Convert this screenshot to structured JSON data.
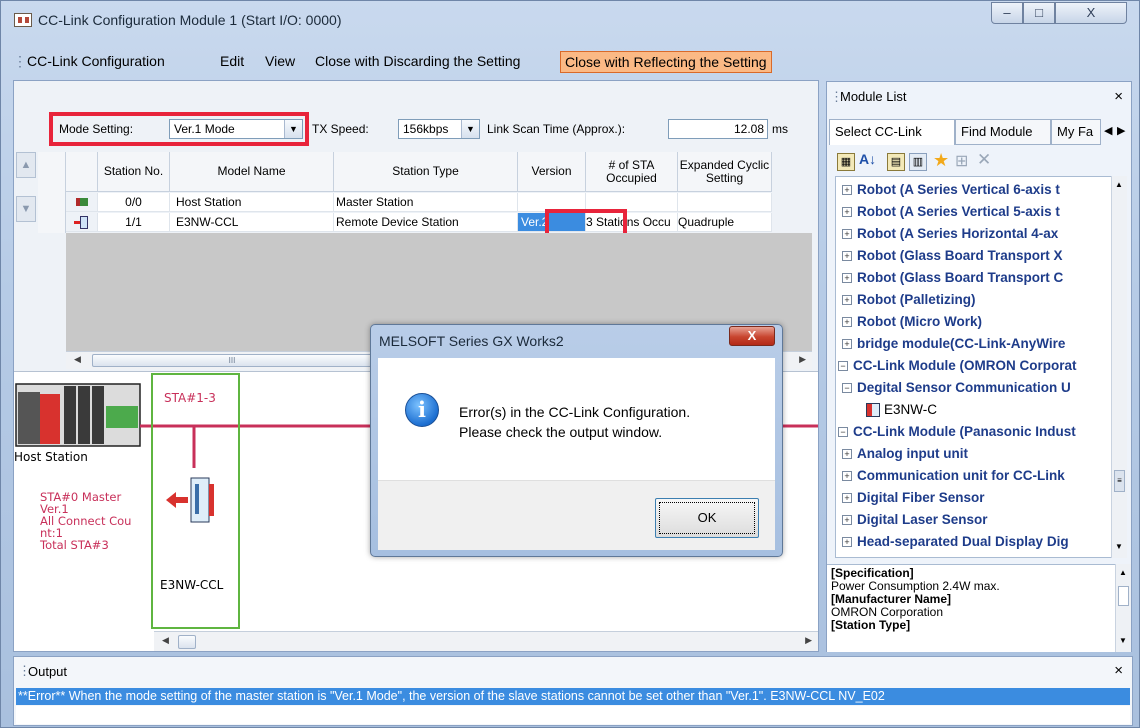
{
  "window": {
    "title": "CC-Link Configuration Module 1 (Start I/O: 0000)",
    "minimize_glyph": "–",
    "maximize_glyph": "□",
    "close_glyph": "X"
  },
  "menu": {
    "items": [
      "CC-Link Configuration",
      "Edit",
      "View",
      "Close with Discarding the Setting",
      "Close with Reflecting the Setting"
    ]
  },
  "settings": {
    "mode_label": "Mode Setting:",
    "mode_value": "Ver.1 Mode",
    "tx_label": "TX Speed:",
    "tx_value": "156kbps",
    "scan_label": "Link Scan Time (Approx.):",
    "scan_value": "12.08",
    "scan_unit": "ms"
  },
  "table": {
    "headers": [
      "Station No.",
      "Model Name",
      "Station Type",
      "Version",
      "# of STA Occupied",
      "Expanded Cyclic Setting"
    ],
    "rows": [
      {
        "icon": "master-station-icon",
        "station": "0/0",
        "model": "Host Station",
        "type": "Master Station",
        "version": "",
        "occupied": "",
        "expanded": ""
      },
      {
        "icon": "remote-device-icon",
        "station": "1/1",
        "model": "E3NW-CCL",
        "type": "Remote Device Station",
        "version": "Ver.2",
        "occupied": "3 Stations Occu",
        "expanded": "Quadruple"
      }
    ],
    "hscroll_glyph": "III"
  },
  "diagram": {
    "host_label": "Host Station",
    "host_info": [
      "STA#0  Master",
      "Ver.1",
      "All Connect Cou",
      "nt:1",
      "Total STA#3"
    ],
    "slave_sta": "STA#1-3",
    "slave_name": "E3NW-CCL"
  },
  "module_list": {
    "title": "Module List",
    "tabs": [
      "Select CC-Link",
      "Find Module",
      "My Fa"
    ],
    "tree": [
      {
        "text": "Robot (A Series Vertical 6-axis t",
        "level": 1,
        "kind": "plus"
      },
      {
        "text": "Robot (A Series Vertical 5-axis t",
        "level": 1,
        "kind": "plus"
      },
      {
        "text": "Robot (A Series Horizontal 4-ax",
        "level": 1,
        "kind": "plus"
      },
      {
        "text": "Robot (Glass Board Transport X",
        "level": 1,
        "kind": "plus"
      },
      {
        "text": "Robot (Glass Board Transport C",
        "level": 1,
        "kind": "plus"
      },
      {
        "text": "Robot (Palletizing)",
        "level": 1,
        "kind": "plus"
      },
      {
        "text": "Robot (Micro Work)",
        "level": 1,
        "kind": "plus"
      },
      {
        "text": "bridge module(CC-Link-AnyWire",
        "level": 1,
        "kind": "plus"
      },
      {
        "text": "CC-Link Module (OMRON Corporat",
        "level": 0,
        "kind": "minus"
      },
      {
        "text": "Degital Sensor Communication U",
        "level": 1,
        "kind": "minus"
      },
      {
        "text": "E3NW-C",
        "level": 2,
        "kind": "leaf"
      },
      {
        "text": "CC-Link Module (Panasonic Indust",
        "level": 0,
        "kind": "minus"
      },
      {
        "text": "Analog input unit",
        "level": 1,
        "kind": "plus"
      },
      {
        "text": "Communication unit for CC-Link",
        "level": 1,
        "kind": "plus"
      },
      {
        "text": "Digital Fiber Sensor",
        "level": 1,
        "kind": "plus"
      },
      {
        "text": "Digital Laser Sensor",
        "level": 1,
        "kind": "plus"
      },
      {
        "text": "Head-separated Dual Display Dig",
        "level": 1,
        "kind": "plus"
      }
    ],
    "spec": [
      {
        "text": "[Specification]",
        "bold": true
      },
      {
        "text": "Power Consumption 2.4W max.",
        "bold": false
      },
      {
        "text": "[Manufacturer Name]",
        "bold": true
      },
      {
        "text": "OMRON Corporation",
        "bold": false
      },
      {
        "text": "[Station Type]",
        "bold": true
      }
    ]
  },
  "output": {
    "title": "Output",
    "close_glyph": "×",
    "error": "**Error** When the mode setting of the master station is \"Ver.1 Mode\", the version of the slave stations cannot be set other than \"Ver.1\".  E3NW-CCL  NV_E02"
  },
  "dialog": {
    "title": "MELSOFT Series GX Works2",
    "message_line1": "Error(s) in the CC-Link Configuration.",
    "message_line2": "Please check the output window.",
    "ok": "OK",
    "close_glyph": "X",
    "icon_glyph": "i"
  },
  "colors": {
    "highlight_red": "#e8243b",
    "menu_highlight": "#fbb985",
    "selection_blue": "#3b8ce0",
    "tree_text": "#1e3c8a",
    "bus_line": "#c8305a",
    "diagram_border": "#5fb540"
  }
}
